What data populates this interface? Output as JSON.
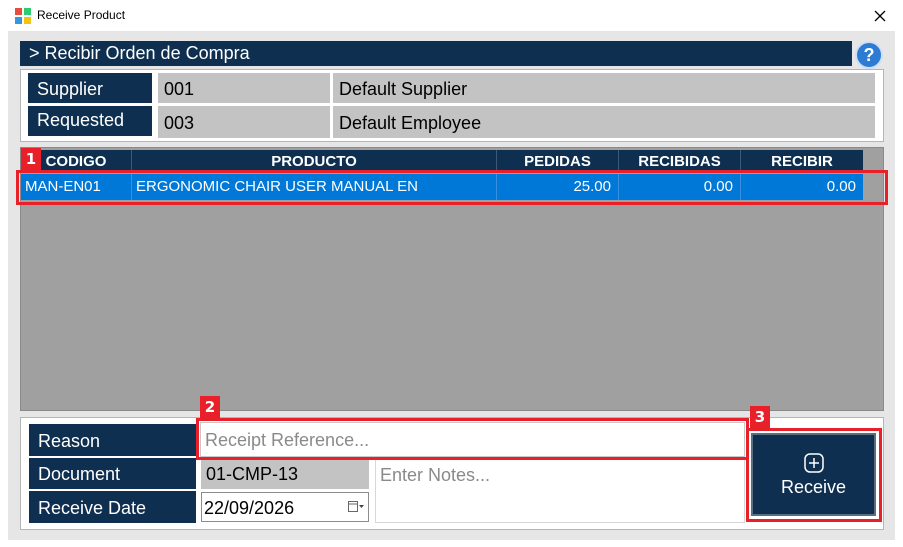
{
  "window": {
    "title": "Receive Product"
  },
  "header": {
    "title": "> Recibir Orden de Compra",
    "help_label": "?"
  },
  "info": {
    "supplier_label": "Supplier",
    "supplier_code": "001",
    "supplier_name": "Default Supplier",
    "requested_label": "Requested",
    "employee_code": "003",
    "employee_name": "Default Employee"
  },
  "grid": {
    "columns": [
      "CODIGO",
      "PRODUCTO",
      "PEDIDAS",
      "RECIBIDAS",
      "RECIBIR"
    ],
    "rows": [
      {
        "codigo": "MAN-EN01",
        "producto": "ERGONOMIC CHAIR USER MANUAL EN",
        "pedidas": "25.00",
        "recibidas": "0.00",
        "recibir": "0.00"
      }
    ]
  },
  "form": {
    "reason_label": "Reason",
    "reason_placeholder": "Receipt Reference...",
    "document_label": "Document",
    "document_value": "01-CMP-13",
    "notes_placeholder": "Enter Notes...",
    "date_label": "Receive Date",
    "date_value": "22/09/2026"
  },
  "actions": {
    "receive_label": "Receive"
  },
  "annotations": [
    "1",
    "2",
    "3"
  ],
  "colors": {
    "navy": "#0e2f4f",
    "selection": "#0078d7",
    "grid_bg": "#a0a0a0",
    "marker": "#e8202a"
  }
}
